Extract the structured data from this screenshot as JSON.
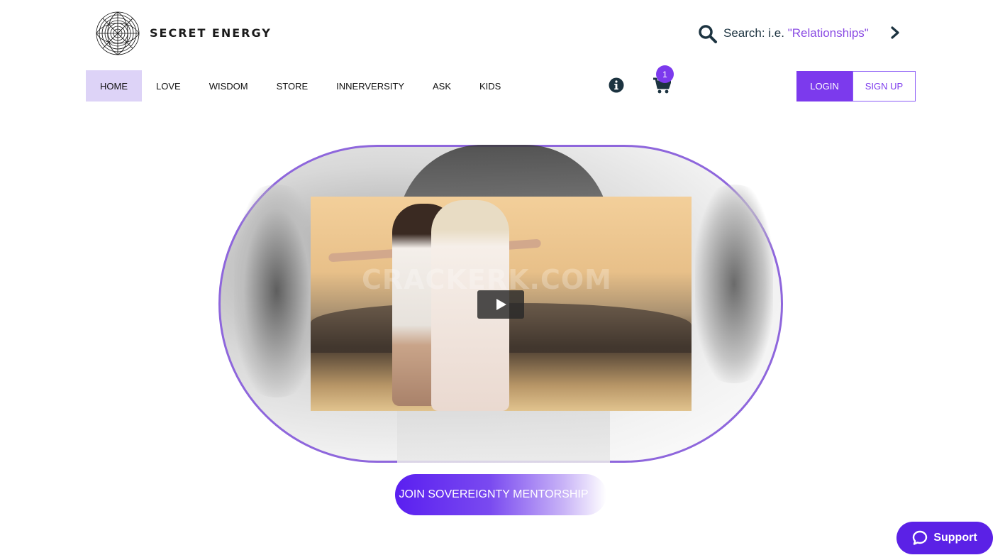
{
  "header": {
    "brand": "SECRET ENERGY",
    "search": {
      "prefix": "Search: i.e. ",
      "example": "\"Relationships\""
    }
  },
  "nav": {
    "items": [
      {
        "label": "HOME",
        "active": true
      },
      {
        "label": "LOVE"
      },
      {
        "label": "WISDOM"
      },
      {
        "label": "STORE"
      },
      {
        "label": "INNERVERSITY"
      },
      {
        "label": "ASK"
      },
      {
        "label": "KIDS"
      }
    ],
    "cart_count": "1",
    "login_label": "LOGIN",
    "signup_label": "SIGN UP"
  },
  "hero": {
    "watermark": "CRACKERK.COM",
    "cta_label": "JOIN SOVEREIGNTY MENTORSHIP"
  },
  "support": {
    "label": "Support"
  },
  "colors": {
    "accent": "#7c3aed",
    "nav_active_bg": "#ddd3f7",
    "support_bg": "#5b21e6",
    "frame_border": "#8e66dc"
  },
  "icons": {
    "logo": "spiral-logo-icon",
    "search": "search-icon",
    "search_go": "chevron-right-icon",
    "info": "info-icon",
    "cart": "cart-icon",
    "play": "play-icon",
    "chat": "chat-bubble-icon"
  }
}
